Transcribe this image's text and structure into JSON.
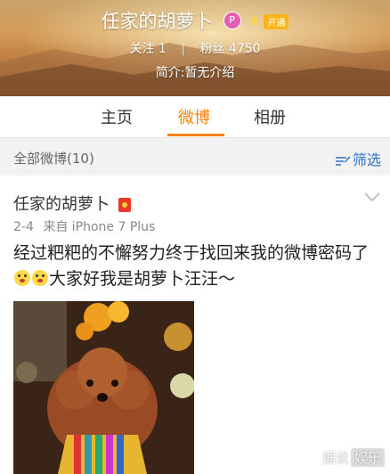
{
  "profile": {
    "name": "任家的胡萝卜",
    "badge_letter": "P",
    "vip_label": "开通",
    "following_label": "关注",
    "following_count": "1",
    "followers_label": "粉丝",
    "followers_count": "4750",
    "intro": "简介:暂无介绍"
  },
  "tabs": [
    {
      "label": "主页",
      "active": false
    },
    {
      "label": "微博",
      "active": true
    },
    {
      "label": "相册",
      "active": false
    }
  ],
  "filterbar": {
    "all_label": "全部微博(10)",
    "filter_label": "筛选"
  },
  "post": {
    "author": "任家的胡萝卜",
    "date": "2-4",
    "source": "来自 iPhone 7 Plus",
    "text_part1": "经过粑粑的不懈努力终于找回来我的微博密码了",
    "text_part2": "大家好我是胡萝卜汪汪～"
  },
  "watermark": {
    "left": "据说",
    "right": "娱乐"
  },
  "colors": {
    "accent": "#ff8200",
    "link": "#2a73c8"
  }
}
